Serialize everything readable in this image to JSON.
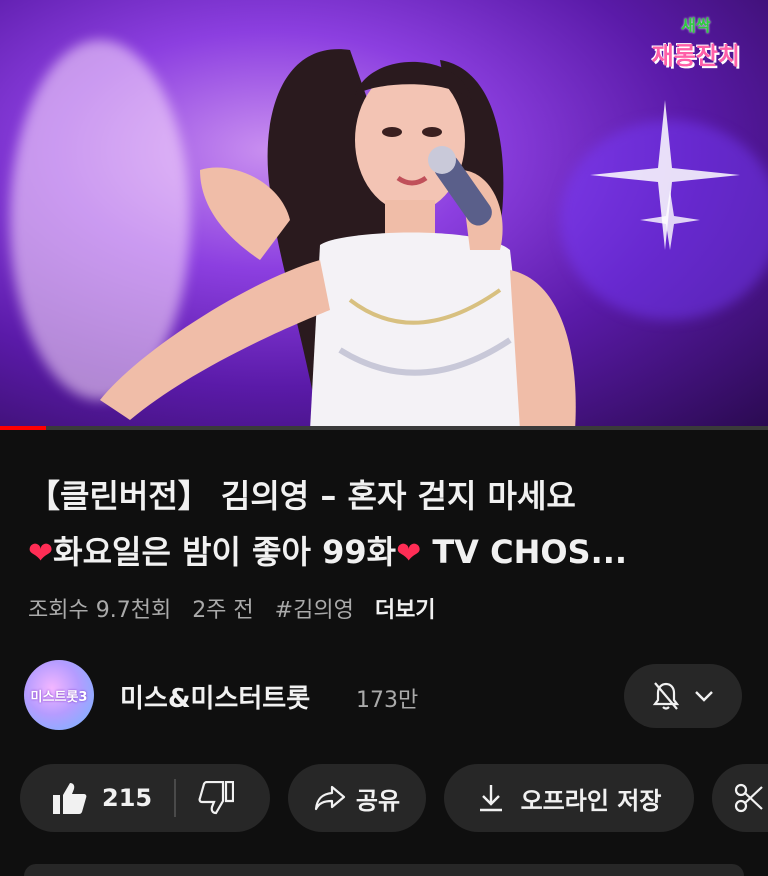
{
  "video": {
    "logo_line1": "새싹",
    "logo_line2": "재롱잔치",
    "progress_fraction": 0.06
  },
  "title": {
    "line1": "【클린버전】 김의영 – 혼자 걷지 마세요",
    "line2_a": "❤",
    "line2_b": "화요일은 밤이 좋아 99화",
    "line2_c": "❤",
    "line2_d": " TV CHOS..."
  },
  "meta": {
    "views": "조회수 9.7천회",
    "age": "2주 전",
    "hashtag": "#김의영",
    "more": "더보기"
  },
  "channel": {
    "avatar_text": "미스트롯3",
    "name": "미스&미스터트롯",
    "subscribers": "173만"
  },
  "actions": {
    "like_count": "215",
    "share_label": "공유",
    "download_label": "오프라인 저장"
  },
  "icons": {
    "like": "thumb-up-icon",
    "dislike": "thumb-down-icon",
    "share": "share-icon",
    "download": "download-icon",
    "clip": "scissors-icon",
    "bell": "bell-off-icon",
    "chevron": "chevron-down-icon"
  }
}
